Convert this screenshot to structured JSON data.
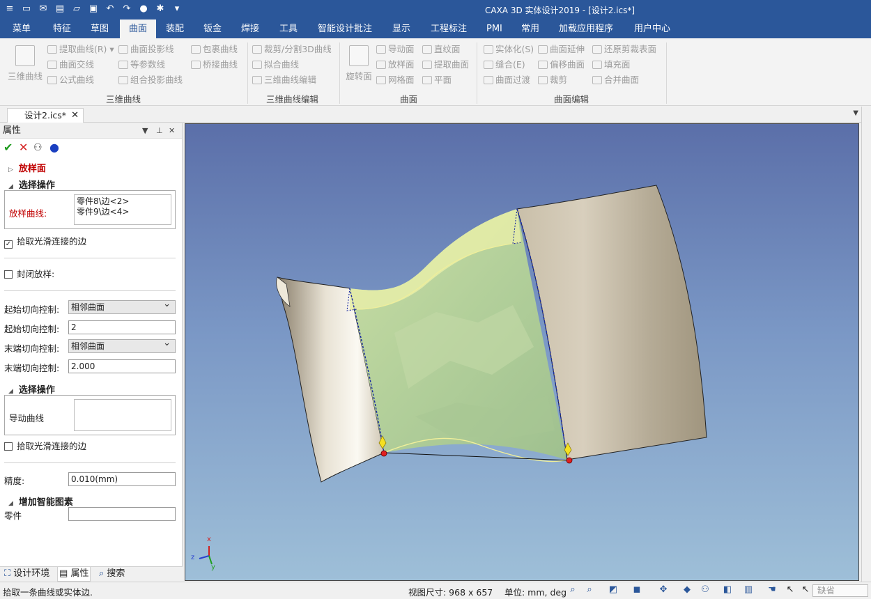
{
  "window": {
    "title": "CAXA 3D 实体设计2019 - [设计2.ics*]"
  },
  "menu": [
    "菜单",
    "特征",
    "草图",
    "曲面",
    "装配",
    "钣金",
    "焊接",
    "工具",
    "智能设计批注",
    "显示",
    "工程标注",
    "PMI",
    "常用",
    "加载应用程序",
    "用户中心"
  ],
  "ribbon": {
    "big_3d_curve": "三维曲线",
    "extract_curve": "提取曲线(R)",
    "surface_intersect": "曲面交线",
    "formula_curve": "公式曲线",
    "surface_projection": "曲面投影线",
    "iso_param": "等参数线",
    "combo_projection": "组合投影曲线",
    "wrap_curve": "包裹曲线",
    "bridge_curve": "桥接曲线",
    "group_3d_curve": "三维曲线",
    "trim_split": "裁剪/分割3D曲线",
    "fit_curve": "拟合曲线",
    "edit_3d_curve": "三维曲线编辑",
    "group_3d_curve_edit": "三维曲线编辑",
    "revolve": "旋转面",
    "guide_surface": "导动面",
    "loft_surface": "放样面",
    "mesh_surface": "网格面",
    "ruled_surface": "直纹面",
    "extract_surface": "提取曲面",
    "plane": "平面",
    "group_surface": "曲面",
    "solidify": "实体化(S)",
    "stitch": "缝合(E)",
    "surface_blend": "曲面过渡",
    "surface_extend": "曲面延伸",
    "offset_surface": "偏移曲面",
    "trim": "裁剪",
    "restore_trim": "还原剪裁表面",
    "fill_surface": "填充面",
    "merge_surface": "合并曲面",
    "group_surface_edit": "曲面编辑"
  },
  "doc_tab": "设计2.ics*",
  "panel": {
    "title": "属性",
    "feature": "放样面",
    "section_select": "选择操作",
    "loft_curve_label": "放样曲线:",
    "loft_curves": [
      "零件8\\边<2>",
      "零件9\\边<4>"
    ],
    "pick_smooth": "拾取光滑连接的边",
    "closed_loft": "封闭放样:",
    "start_tangent_label": "起始切向控制:",
    "start_tangent_value": "相邻曲面",
    "start_tangent_mag_label": "起始切向控制:",
    "start_tangent_mag": "2",
    "end_tangent_label": "末端切向控制:",
    "end_tangent_value": "相邻曲面",
    "end_tangent_mag_label": "末端切向控制:",
    "end_tangent_mag": "2.000",
    "section_select2": "选择操作",
    "guide_curve_label": "导动曲线",
    "pick_smooth2": "拾取光滑连接的边",
    "precision_label": "精度:",
    "precision_value": "0.010(mm)",
    "section_smart": "增加智能图素",
    "part_label": "零件",
    "part_value": ""
  },
  "panel_tabs": [
    "设计环境",
    "属性",
    "搜索"
  ],
  "status": {
    "prompt": "拾取一条曲线或实体边.",
    "view_size": "视图尺寸: 968 x 657",
    "units": "单位: mm, deg",
    "mode": "缺省"
  },
  "axis": {
    "x": "x",
    "y": "y",
    "z": "z"
  }
}
